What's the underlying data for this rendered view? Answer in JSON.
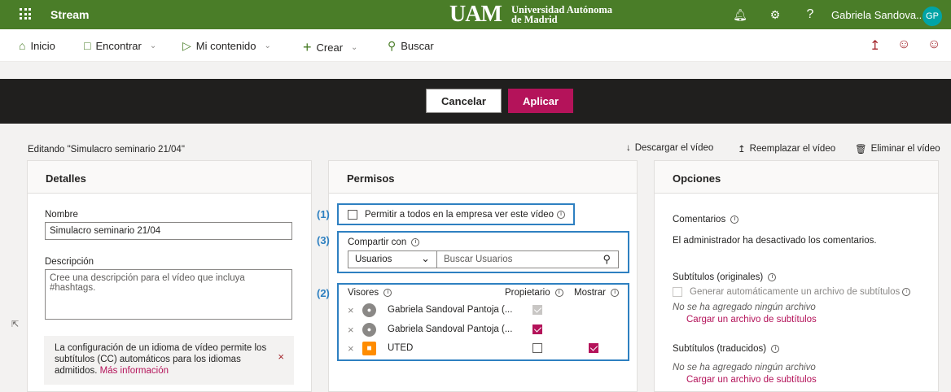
{
  "topbar": {
    "app_name": "Stream",
    "logo_mark": "UAM",
    "logo_line1": "Universidad Autónoma",
    "logo_line2": "de Madrid",
    "user_name": "Gabriela Sandova...",
    "avatar_initials": "GP",
    "color": "#4a7d28"
  },
  "nav": {
    "home": "Inicio",
    "discover": "Encontrar",
    "my_content": "Mi contenido",
    "create": "Crear",
    "search": "Buscar"
  },
  "actions": {
    "cancel": "Cancelar",
    "apply": "Aplicar",
    "accent": "#b4135a"
  },
  "editing_title": "Editando \"Simulacro seminario 21/04\"",
  "file_actions": {
    "download": "Descargar el vídeo",
    "replace": "Reemplazar el vídeo",
    "delete": "Eliminar el vídeo"
  },
  "details": {
    "title": "Detalles",
    "name_label": "Nombre",
    "name_value": "Simulacro seminario 21/04",
    "description_label": "Descripción",
    "description_placeholder": "Cree una descripción para el vídeo que incluya #hashtags.",
    "info_text": "La configuración de un idioma de vídeo permite los subtítulos (CC) automáticos para los idiomas admitidos.",
    "info_link": "Más información"
  },
  "permissions": {
    "title": "Permisos",
    "marker1": "(1)",
    "marker2": "(2)",
    "marker3": "(3)",
    "allow_company": "Permitir a todos en la empresa ver este vídeo",
    "share_with": "Compartir con",
    "share_select": "Usuarios",
    "share_search_placeholder": "Buscar Usuarios",
    "viewers_label": "Visores",
    "owner_label": "Propietario",
    "show_label": "Mostrar",
    "viewers": [
      {
        "name": "Gabriela Sandoval Pantoja (...",
        "owner": "disabled-checked",
        "show": "none"
      },
      {
        "name": "Gabriela Sandoval Pantoja (...",
        "owner": "checked",
        "show": "none"
      },
      {
        "name": "UTED",
        "owner": "unchecked",
        "show": "checked"
      }
    ]
  },
  "options": {
    "title": "Opciones",
    "comments_label": "Comentarios",
    "comments_text": "El administrador ha desactivado los comentarios.",
    "subs_original_label": "Subtítulos (originales)",
    "auto_generate": "Generar automáticamente un archivo de subtítulos",
    "no_file_1": "No se ha agregado ningún archivo",
    "upload_1": "Cargar un archivo de subtítulos",
    "subs_translated_label": "Subtítulos (traducidos)",
    "no_file_2": "No se ha agregado ningún archivo",
    "upload_2": "Cargar un archivo de subtítulos"
  }
}
